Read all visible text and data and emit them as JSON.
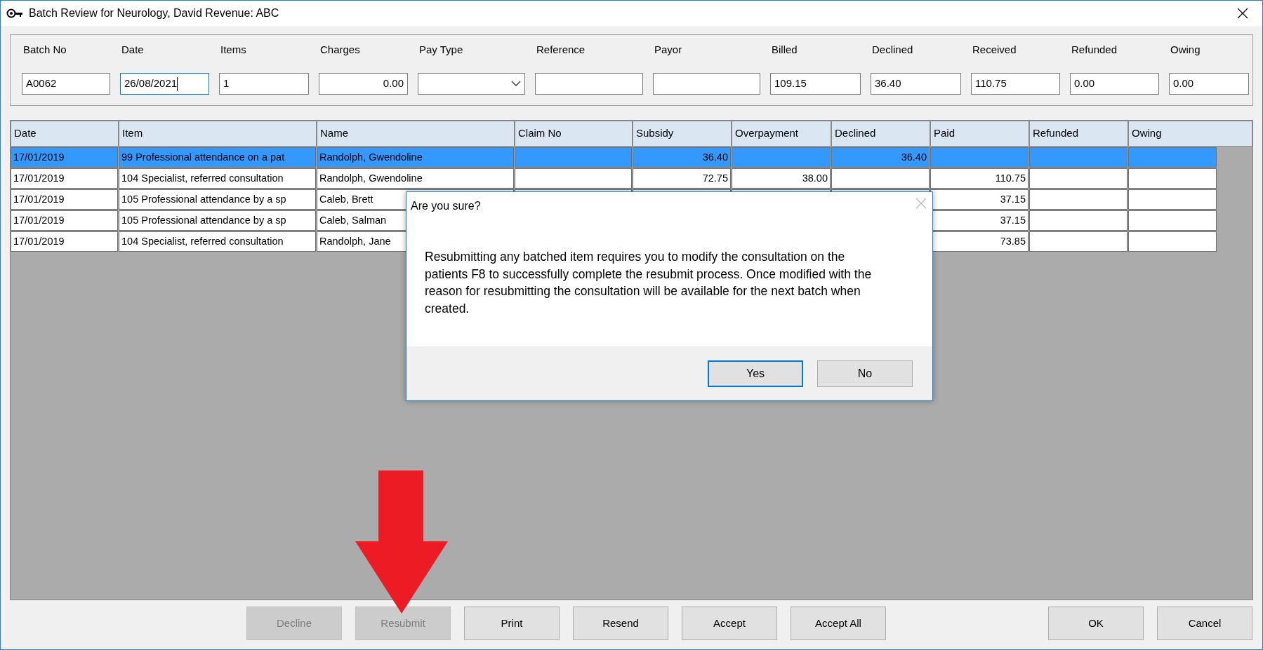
{
  "window": {
    "title": "Batch Review for Neurology, David Revenue: ABC"
  },
  "header_fields": [
    {
      "label": "Batch No",
      "value": "A0062",
      "kind": "text",
      "focused": false
    },
    {
      "label": "Date",
      "value": "26/08/2021",
      "kind": "text",
      "focused": true
    },
    {
      "label": "Items",
      "value": "1",
      "kind": "text",
      "focused": false
    },
    {
      "label": "Charges",
      "value": "0.00",
      "kind": "amount",
      "focused": false
    },
    {
      "label": "Pay Type",
      "kind": "dropdown",
      "focused": false
    },
    {
      "label": "Reference",
      "kind": "text",
      "focused": false
    },
    {
      "label": "Payor",
      "kind": "text",
      "focused": false
    },
    {
      "label": "Billed",
      "value": "109.15",
      "kind": "text",
      "focused": false
    },
    {
      "label": "Declined",
      "value": "36.40",
      "kind": "text",
      "focused": false
    },
    {
      "label": "Received",
      "value": "110.75",
      "kind": "text",
      "focused": false
    },
    {
      "label": "Refunded",
      "value": "0.00",
      "kind": "text",
      "focused": false
    },
    {
      "label": "Owing",
      "value": "0.00",
      "kind": "text",
      "focused": false
    }
  ],
  "table": {
    "columns": [
      "Date",
      "Item",
      "Name",
      "Claim No",
      "Subsidy",
      "Overpayment",
      "Declined",
      "Paid",
      "Refunded",
      "Owing"
    ],
    "rows": [
      {
        "selected": true,
        "cells": [
          "17/01/2019",
          "99 Professional attendance on a pat",
          "Randolph, Gwendoline",
          null,
          "36.40",
          null,
          "36.40",
          null,
          null,
          null
        ]
      },
      {
        "selected": false,
        "cells": [
          "17/01/2019",
          "104 Specialist, referred consultation",
          "Randolph, Gwendoline",
          null,
          "72.75",
          "38.00",
          null,
          "110.75",
          null,
          null
        ]
      },
      {
        "selected": false,
        "cells": [
          "17/01/2019",
          "105 Professional attendance by a sp",
          "Caleb, Brett",
          null,
          null,
          null,
          null,
          "37.15",
          null,
          null
        ]
      },
      {
        "selected": false,
        "cells": [
          "17/01/2019",
          "105 Professional attendance by a sp",
          "Caleb, Salman",
          null,
          null,
          null,
          null,
          "37.15",
          null,
          null
        ]
      },
      {
        "selected": false,
        "cells": [
          "17/01/2019",
          "104 Specialist, referred consultation",
          "Randolph, Jane",
          null,
          null,
          null,
          null,
          "73.85",
          null,
          null
        ]
      }
    ]
  },
  "dialog": {
    "title": "Are you sure?",
    "message": "Resubmitting any batched item requires you to modify the consultation on the patients F8 to successfully complete the resubmit process. Once modified with the reason for resubmitting the consultation will be available for the next batch when created.",
    "buttons": [
      {
        "label": "Yes",
        "default": true
      },
      {
        "label": "No",
        "default": false
      }
    ]
  },
  "buttons": [
    {
      "label": "Decline",
      "disabled": true
    },
    {
      "label": "Resubmit",
      "disabled": true
    },
    {
      "label": "Print",
      "disabled": false
    },
    {
      "label": "Resend",
      "disabled": false
    },
    {
      "label": "Accept",
      "disabled": false
    },
    {
      "label": "Accept All",
      "disabled": false
    }
  ],
  "dialog_buttons": [
    {
      "label": "OK",
      "disabled": false
    },
    {
      "label": "Cancel",
      "disabled": false
    }
  ]
}
